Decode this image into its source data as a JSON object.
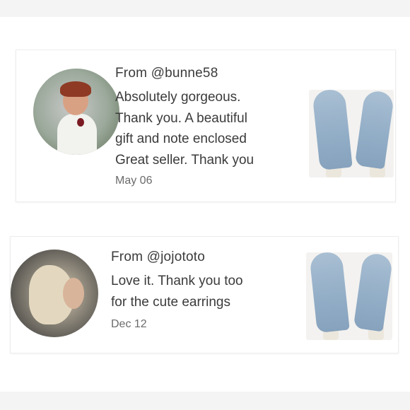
{
  "reviews": [
    {
      "from": "From @bunne58",
      "message_lines": [
        "Absolutely gorgeous.",
        "Thank you. A beautiful",
        "gift and note enclosed",
        "Great seller. Thank you"
      ],
      "date": "May 06"
    },
    {
      "from": "From @jojototo",
      "message_lines": [
        "Love it. Thank you too",
        "for the cute earrings"
      ],
      "date": "Dec 12"
    }
  ],
  "colors": {
    "text": "#3b3b3b",
    "date": "#6b6b6b",
    "cardigan": "#93aec7"
  }
}
